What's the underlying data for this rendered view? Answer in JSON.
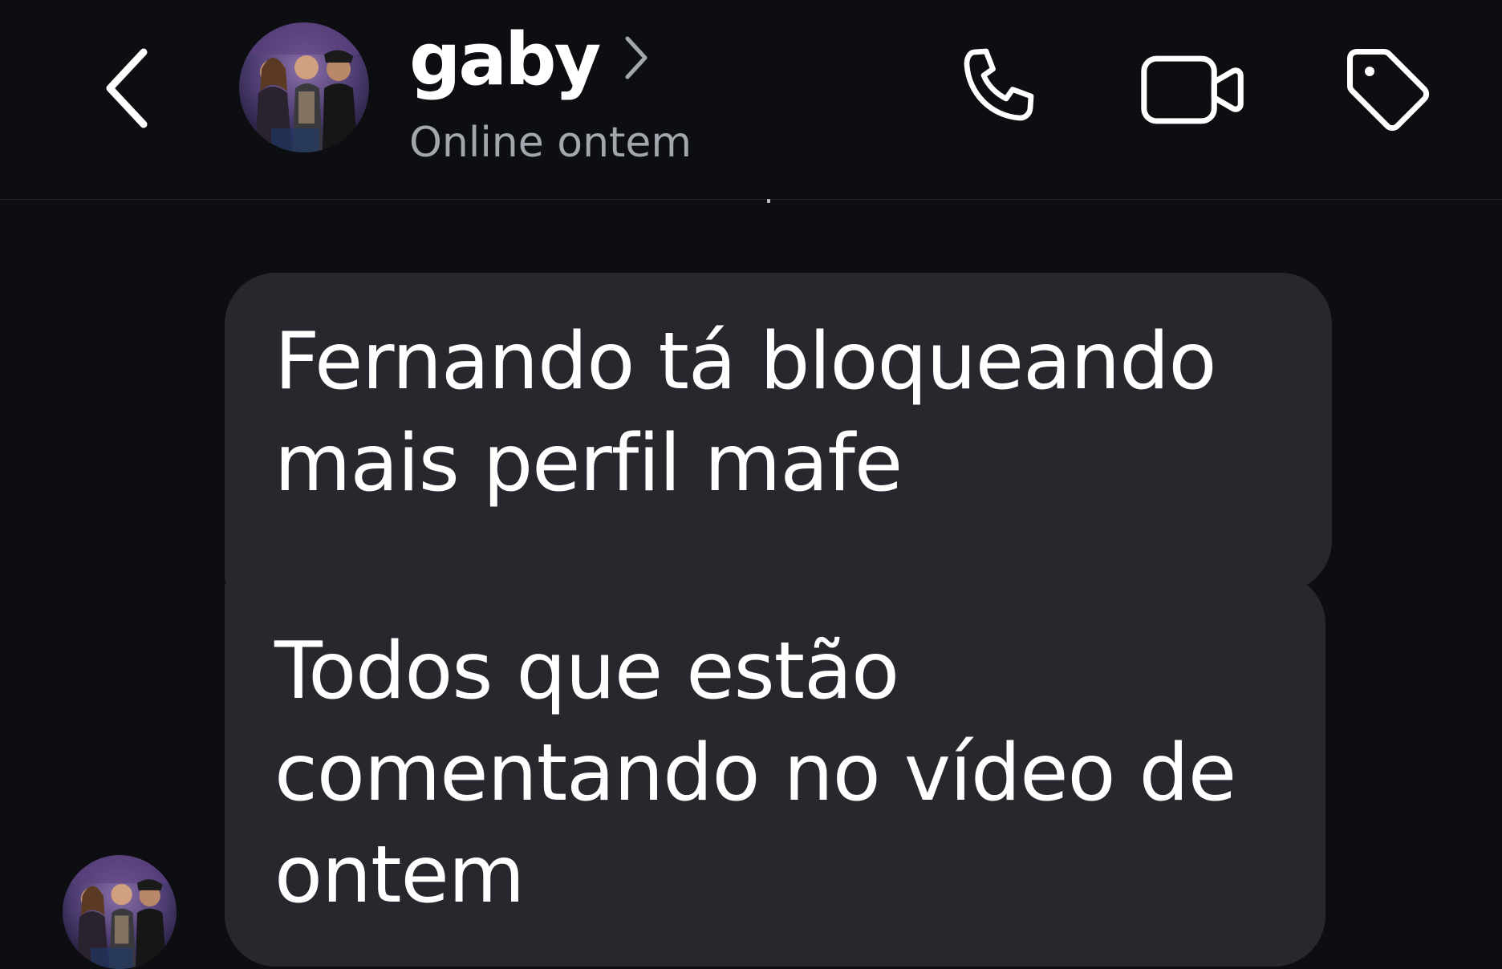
{
  "header": {
    "contact_name": "gaby",
    "status": "Online ontem",
    "icons": {
      "back": "chevron-left-icon",
      "name_chevron": "chevron-right-icon",
      "call": "phone-icon",
      "video": "video-camera-icon",
      "tag": "tag-icon"
    }
  },
  "messages": [
    {
      "text": "Fernando  tá bloqueando\nmais perfil mafe",
      "sender": "gaby"
    },
    {
      "text": "Todos que estão\ncomentando no vídeo de\nontem",
      "sender": "gaby"
    }
  ],
  "colors": {
    "background": "#0d0e12",
    "bubble": "#26282e",
    "text": "#ffffff",
    "status_text": "#a2a6ad"
  }
}
